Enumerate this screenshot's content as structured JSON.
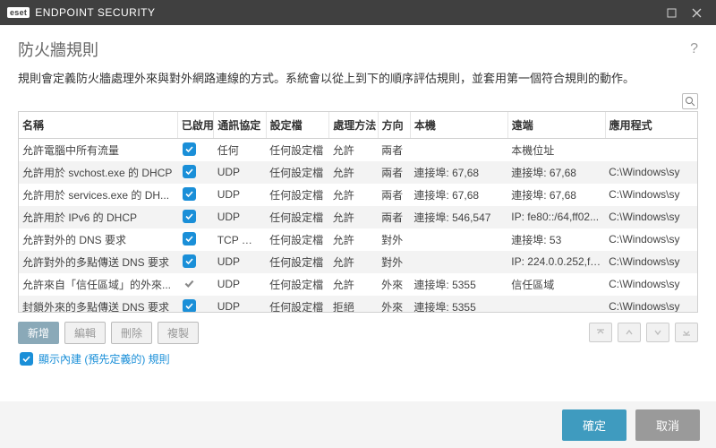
{
  "titlebar": {
    "badge": "eset",
    "product": "ENDPOINT SECURITY"
  },
  "heading": "防火牆規則",
  "description": "規則會定義防火牆處理外來與對外網路連線的方式。系統會以從上到下的順序評估規則，並套用第一個符合規則的動作。",
  "columns": {
    "name": "名稱",
    "enabled": "已啟用",
    "protocol": "通訊協定",
    "profile": "設定檔",
    "method": "處理方法",
    "direction": "方向",
    "local": "本機",
    "remote": "遠端",
    "app": "應用程式"
  },
  "rows": [
    {
      "name": "允許電腦中所有流量",
      "en": "check",
      "proto": "任何",
      "prof": "任何設定檔",
      "meth": "允許",
      "dir": "兩者",
      "loc": "",
      "rem": "本機位址",
      "app": ""
    },
    {
      "name": "允許用於 svchost.exe 的 DHCP",
      "en": "check",
      "proto": "UDP",
      "prof": "任何設定檔",
      "meth": "允許",
      "dir": "兩者",
      "loc": "連接埠: 67,68",
      "rem": "連接埠: 67,68",
      "app": "C:\\Windows\\sy"
    },
    {
      "name": "允許用於 services.exe 的 DH...",
      "en": "check",
      "proto": "UDP",
      "prof": "任何設定檔",
      "meth": "允許",
      "dir": "兩者",
      "loc": "連接埠: 67,68",
      "rem": "連接埠: 67,68",
      "app": "C:\\Windows\\sy"
    },
    {
      "name": "允許用於 IPv6 的 DHCP",
      "en": "check",
      "proto": "UDP",
      "prof": "任何設定檔",
      "meth": "允許",
      "dir": "兩者",
      "loc": "連接埠: 546,547",
      "rem": "IP: fe80::/64,ff02...",
      "app": "C:\\Windows\\sy"
    },
    {
      "name": "允許對外的 DNS 要求",
      "en": "check",
      "proto": "TCP 與 ...",
      "prof": "任何設定檔",
      "meth": "允許",
      "dir": "對外",
      "loc": "",
      "rem": "連接埠: 53",
      "app": "C:\\Windows\\sy"
    },
    {
      "name": "允許對外的多點傳送 DNS 要求",
      "en": "check",
      "proto": "UDP",
      "prof": "任何設定檔",
      "meth": "允許",
      "dir": "對外",
      "loc": "",
      "rem": "IP: 224.0.0.252,ff...",
      "app": "C:\\Windows\\sy"
    },
    {
      "name": "允許來自「信任區域」的外來...",
      "en": "gray",
      "proto": "UDP",
      "prof": "任何設定檔",
      "meth": "允許",
      "dir": "外來",
      "loc": "連接埠: 5355",
      "rem": "信任區域",
      "app": "C:\\Windows\\sy"
    },
    {
      "name": "封鎖外來的多點傳送 DNS 要求",
      "en": "check",
      "proto": "UDP",
      "prof": "任何設定檔",
      "meth": "拒絕",
      "dir": "外來",
      "loc": "連接埠: 5355",
      "rem": "",
      "app": "C:\\Windows\\sy"
    }
  ],
  "toolbar": {
    "add": "新增",
    "edit": "編輯",
    "delete": "刪除",
    "copy": "複製"
  },
  "show_builtin": "顯示內建 (預先定義的) 規則",
  "footer": {
    "ok": "確定",
    "cancel": "取消"
  }
}
